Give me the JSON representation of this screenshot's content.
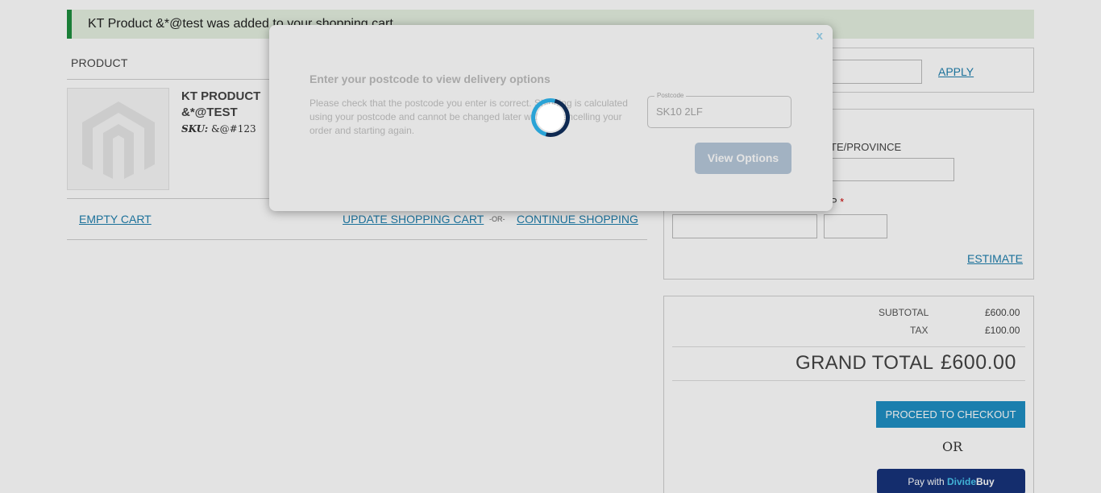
{
  "message": {
    "text": "KT Product &*@test was added to your shopping cart."
  },
  "cart": {
    "header_product": "PRODUCT",
    "item": {
      "name_line1": "KT PRODUCT",
      "name_line2": "&*@TEST",
      "sku_label": "SKU:",
      "sku_value": "&@#123"
    },
    "empty_cart": "EMPTY CART",
    "update_cart": "UPDATE SHOPPING CART",
    "or_small": "-OR-",
    "continue_shopping": "CONTINUE SHOPPING"
  },
  "coupon": {
    "apply": "APPLY"
  },
  "shipping": {
    "state_label": "TE/PROVINCE",
    "zip_label": "P",
    "zip_required": "*",
    "estimate": "ESTIMATE"
  },
  "totals": {
    "subtotal_label": "SUBTOTAL",
    "subtotal_value": "£600.00",
    "tax_label": "TAX",
    "tax_value": "£100.00",
    "grand_label": "GRAND TOTAL",
    "grand_value": "£600.00",
    "checkout": "PROCEED TO CHECKOUT",
    "or": "OR",
    "divide_prefix": "Pay with ",
    "divide_brand": "Divide",
    "divide_brand2": "Buy"
  },
  "modal": {
    "close": "x",
    "title": "Enter your postcode to view delivery options",
    "description": "Please check that the postcode you enter is correct. Shipping is calculated using your postcode and cannot be changed later without cancelling your order and starting again.",
    "postcode_legend": "Postcode",
    "postcode_value": "SK10 2LF",
    "view_options": "View Options"
  },
  "colors": {
    "accent": "#1f8fc4",
    "link": "#1f7fae",
    "success": "#1e8e3e",
    "divide": "#17337b"
  }
}
